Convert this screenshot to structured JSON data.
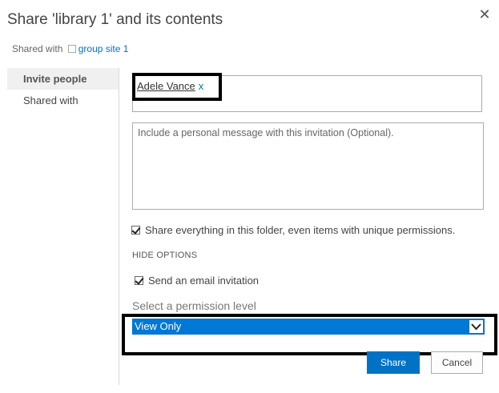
{
  "dialog": {
    "title": "Share 'library 1' and its contents",
    "shared_with_label": "Shared with",
    "shared_with_group": "group site 1"
  },
  "nav": {
    "items": [
      {
        "label": "Invite people",
        "selected": true
      },
      {
        "label": "Shared with",
        "selected": false
      }
    ]
  },
  "invite": {
    "person_name": "Adele Vance",
    "remove_label": "x",
    "message_placeholder": "Include a personal message with this invitation (Optional).",
    "share_everything_label": "Share everything in this folder, even items with unique permissions.",
    "share_everything_checked": true,
    "hide_options_label": "HIDE OPTIONS",
    "send_email_label": "Send an email invitation",
    "send_email_checked": true,
    "permission_label": "Select a permission level",
    "permission_value": "View Only"
  },
  "buttons": {
    "share": "Share",
    "cancel": "Cancel"
  },
  "colors": {
    "accent": "#0072c6",
    "selected_select_bg": "#0078d7"
  }
}
